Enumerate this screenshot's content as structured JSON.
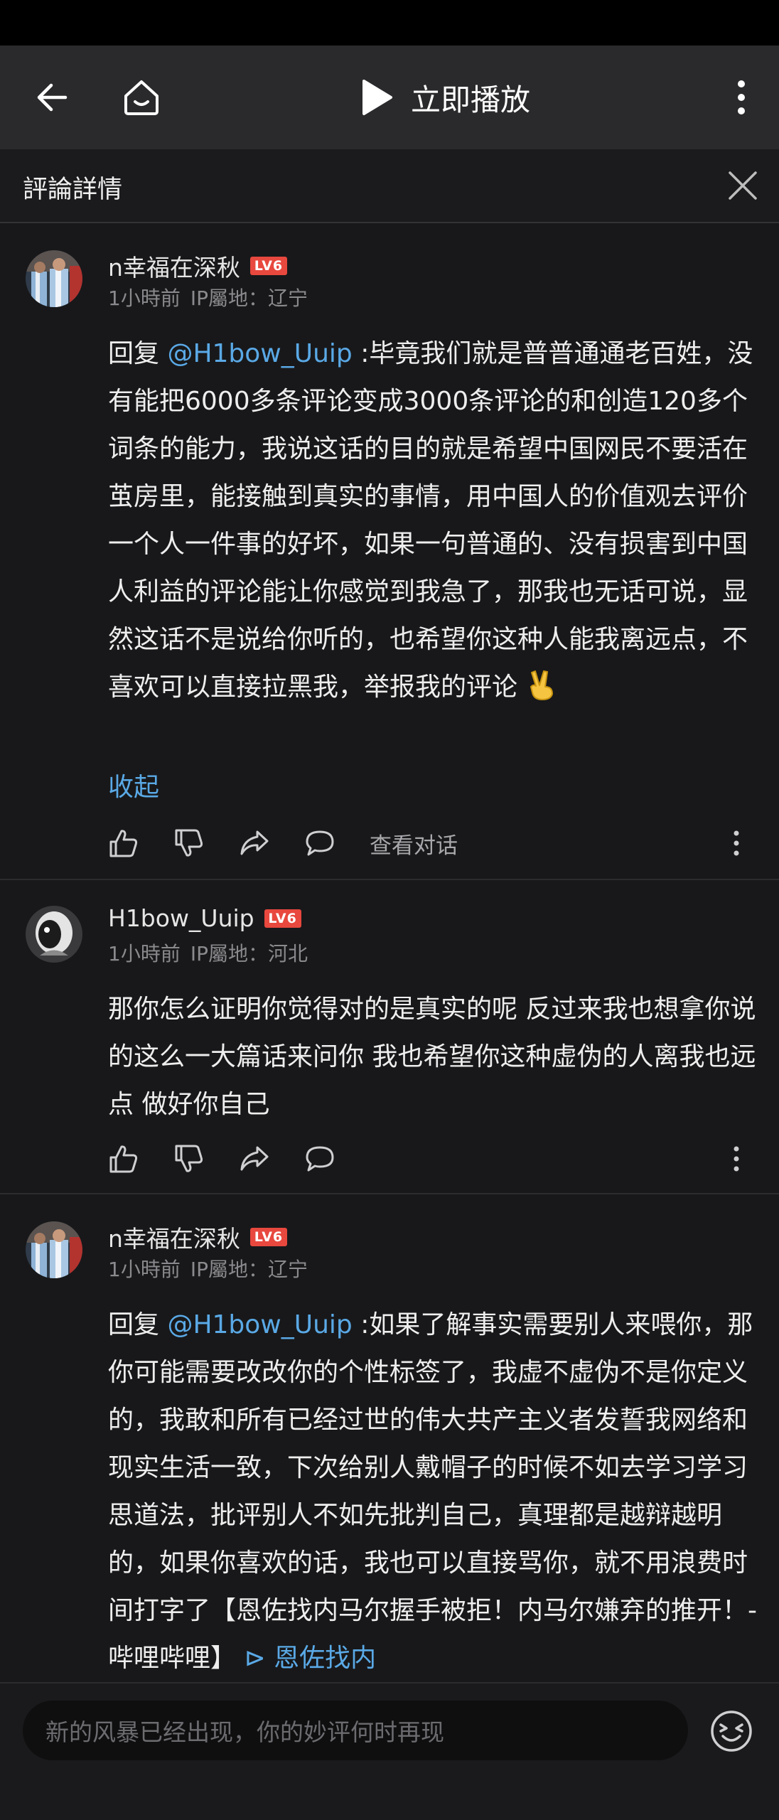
{
  "header": {
    "play_label": "立即播放"
  },
  "sheet": {
    "title": "評論詳情"
  },
  "comments": [
    {
      "username": "n幸福在深秋",
      "level": "LV6",
      "time": "1小時前",
      "ip": "IP屬地：辽宁",
      "reply_prefix": "回复 ",
      "mention": "@H1bow_Uuip",
      "text": " :毕竟我们就是普普通通老百姓，没有能把6000多条评论变成3000条评论的和创造120多个词条的能力，我说这话的目的就是希望中国网民不要活在茧房里，能接触到真实的事情，用中国人的价值观去评价一个人一件事的好坏，如果一句普通的、没有损害到中国人利益的评论能让你感觉到我急了，那我也无话可说，显然这话不是说给你听的，也希望你这种人能我离远点，不喜欢可以直接拉黑我，举报我的评论",
      "collapse_label": "收起",
      "view_conversation": "查看对话"
    },
    {
      "username": "H1bow_Uuip",
      "level": "LV6",
      "time": "1小時前",
      "ip": "IP屬地：河北",
      "text": "那你怎么证明你觉得对的是真实的呢 反过来我也想拿你说的这么一大篇话来问你 我也希望你这种虚伪的人离我也远点 做好你自己"
    },
    {
      "username": "n幸福在深秋",
      "level": "LV6",
      "time": "1小時前",
      "ip": "IP屬地：辽宁",
      "reply_prefix": "回复 ",
      "mention": "@H1bow_Uuip",
      "text": " :如果了解事实需要别人来喂你，那你可能需要改改你的个性标签了，我虚不虚伪不是你定义的，我敢和所有已经过世的伟大共产主义者发誓我网络和现实生活一致，下次给别人戴帽子的时候不如去学习学习思道法，批评别人不如先批判自己，真理都是越辩越明的，如果你喜欢的话，我也可以直接骂你，就不用浪费时间打字了【恩佐找内马尔握手被拒！内马尔嫌弃的推开！-哔哩哔哩】",
      "video_link": "⊳ 恩佐找内"
    }
  ],
  "input": {
    "placeholder": "新的风暴已经出现，你的妙评何时再现"
  },
  "icons": {
    "back": "back-arrow-icon",
    "home": "home-icon",
    "play": "play-icon",
    "more": "more-vertical-icon",
    "close": "close-icon",
    "like": "thumbs-up-icon",
    "dislike": "thumbs-down-icon",
    "share": "share-icon",
    "reply": "comment-bubble-icon",
    "emoji": "emoji-face-icon"
  },
  "colors": {
    "background": "#18181a",
    "accent_link": "#5aa9e6",
    "level_badge": "#e8483e"
  }
}
